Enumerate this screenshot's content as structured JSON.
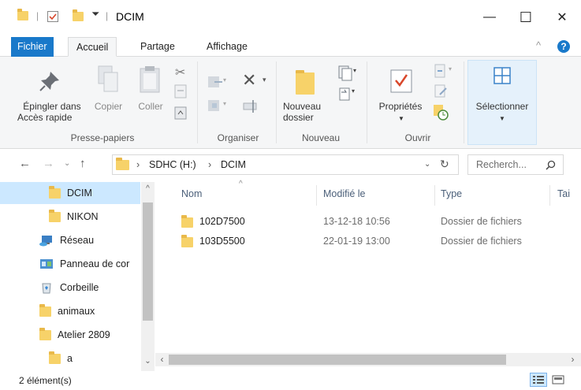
{
  "window": {
    "title": "DCIM",
    "minimize": "—",
    "maximize": "☐",
    "close": "✕"
  },
  "ribbon_tabs": {
    "file": "Fichier",
    "home": "Accueil",
    "share": "Partage",
    "view": "Affichage",
    "collapse": "^",
    "help": "?"
  },
  "ribbon": {
    "pin_line1": "Épingler dans",
    "pin_line2": "Accès rapide",
    "copy": "Copier",
    "paste": "Coller",
    "clipboard_group": "Presse-papiers",
    "organize_group": "Organiser",
    "new_folder_line1": "Nouveau",
    "new_folder_line2": "dossier",
    "new_group": "Nouveau",
    "properties": "Propriétés",
    "open_group": "Ouvrir",
    "select": "Sélectionner"
  },
  "address": {
    "drive": "SDHC (H:)",
    "folder": "DCIM",
    "search_placeholder": "Recherch..."
  },
  "nav_items": [
    {
      "label": "DCIM",
      "icon": "folder-icon",
      "selected": true
    },
    {
      "label": "NIKON",
      "icon": "folder-icon",
      "selected": false
    },
    {
      "label": "Réseau",
      "icon": "network-icon",
      "selected": false
    },
    {
      "label": "Panneau de cor",
      "icon": "control-panel-icon",
      "selected": false
    },
    {
      "label": "Corbeille",
      "icon": "recycle-bin-icon",
      "selected": false
    },
    {
      "label": "animaux",
      "icon": "folder-icon",
      "selected": false
    },
    {
      "label": "Atelier 2809",
      "icon": "folder-icon",
      "selected": false
    },
    {
      "label": "a",
      "icon": "folder-icon",
      "selected": false
    }
  ],
  "columns": {
    "name": "Nom",
    "modified": "Modifié le",
    "type": "Type",
    "size": "Tai"
  },
  "files": [
    {
      "name": "102D7500",
      "modified": "13-12-18 10:56",
      "type": "Dossier de fichiers"
    },
    {
      "name": "103D5500",
      "modified": "22-01-19 13:00",
      "type": "Dossier de fichiers"
    }
  ],
  "status": {
    "count": "2 élément(s)"
  },
  "colors": {
    "accent": "#1979ca",
    "folder": "#f7d269",
    "selected_bg": "#cce8ff",
    "ribbon_bg": "#f5f6f7"
  }
}
